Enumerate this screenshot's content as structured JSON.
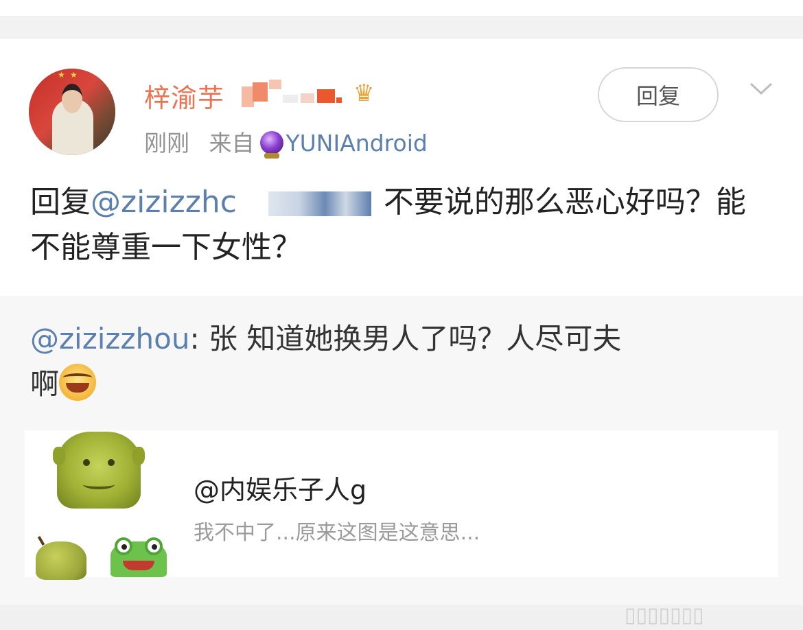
{
  "post": {
    "username": "梓渝芋",
    "crown_icon": "crown-icon",
    "timestamp": "刚刚",
    "source_prefix": "来自",
    "source_app": "YUNIAndroid",
    "reply_button": "回复",
    "body_prefix": "回复",
    "body_mention": "@zizizzhc",
    "body_line1_rest": "不要说的那么恶心好吗？能",
    "body_line2": "不能尊重一下女性？"
  },
  "quote": {
    "mention": "@zizizzhou",
    "mention_tail": "zhou",
    "text_line1": ": 张 知道她换男人了吗？人尽可夫",
    "text_line2": "啊"
  },
  "link_card": {
    "title": "@内娱乐子人g",
    "subtitle": "我不中了...原来这图是这意思..."
  },
  "colors": {
    "username": "#eb7350",
    "link": "#5b7fae",
    "meta": "#939393",
    "body": "#222222"
  }
}
